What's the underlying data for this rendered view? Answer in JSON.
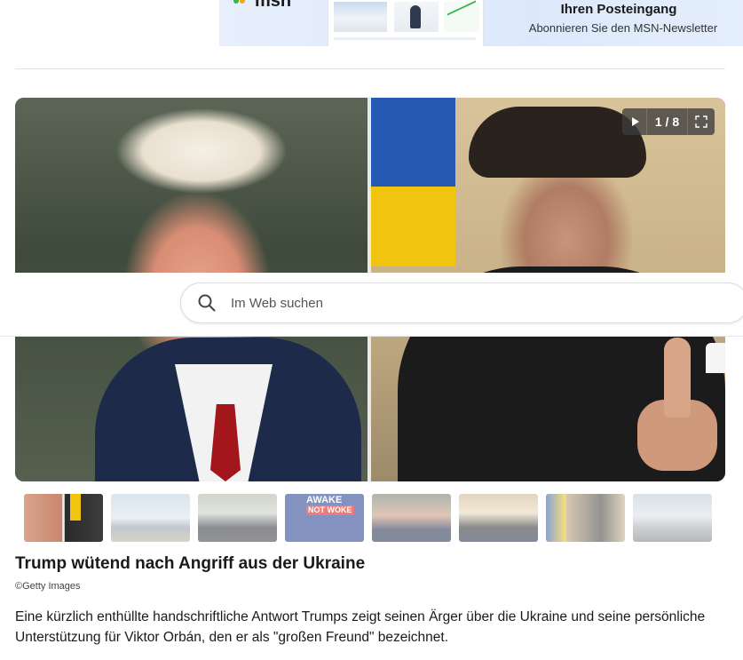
{
  "banner": {
    "logo_text": "msn",
    "title": "Ihren Posteingang",
    "subtitle": "Abonnieren Sie den MSN-Newsletter"
  },
  "slideshow": {
    "counter": "1 / 8",
    "play_icon": "play-icon",
    "fullscreen_icon": "fullscreen-icon",
    "total_thumbnails": 8
  },
  "search": {
    "placeholder": "Im Web suchen",
    "icon": "search-icon"
  },
  "article": {
    "headline": "Trump wütend nach Angriff aus der Ukraine",
    "credit": "©Getty Images",
    "body": "Eine kürzlich enthüllte handschriftliche Antwort Trumps zeigt seinen Ärger über die Ukraine und seine persönliche Unterstützung für Viktor Orbán, den er als \"großen Freund\" bezeichnet."
  },
  "thumbnail_texts": {
    "t4_line1": "AWAKE",
    "t4_line2": "NOT WOKE"
  },
  "colors": {
    "accent_green": "#39b54a",
    "accent_orange": "#f7a800",
    "banner_bg": "#e7effc"
  }
}
